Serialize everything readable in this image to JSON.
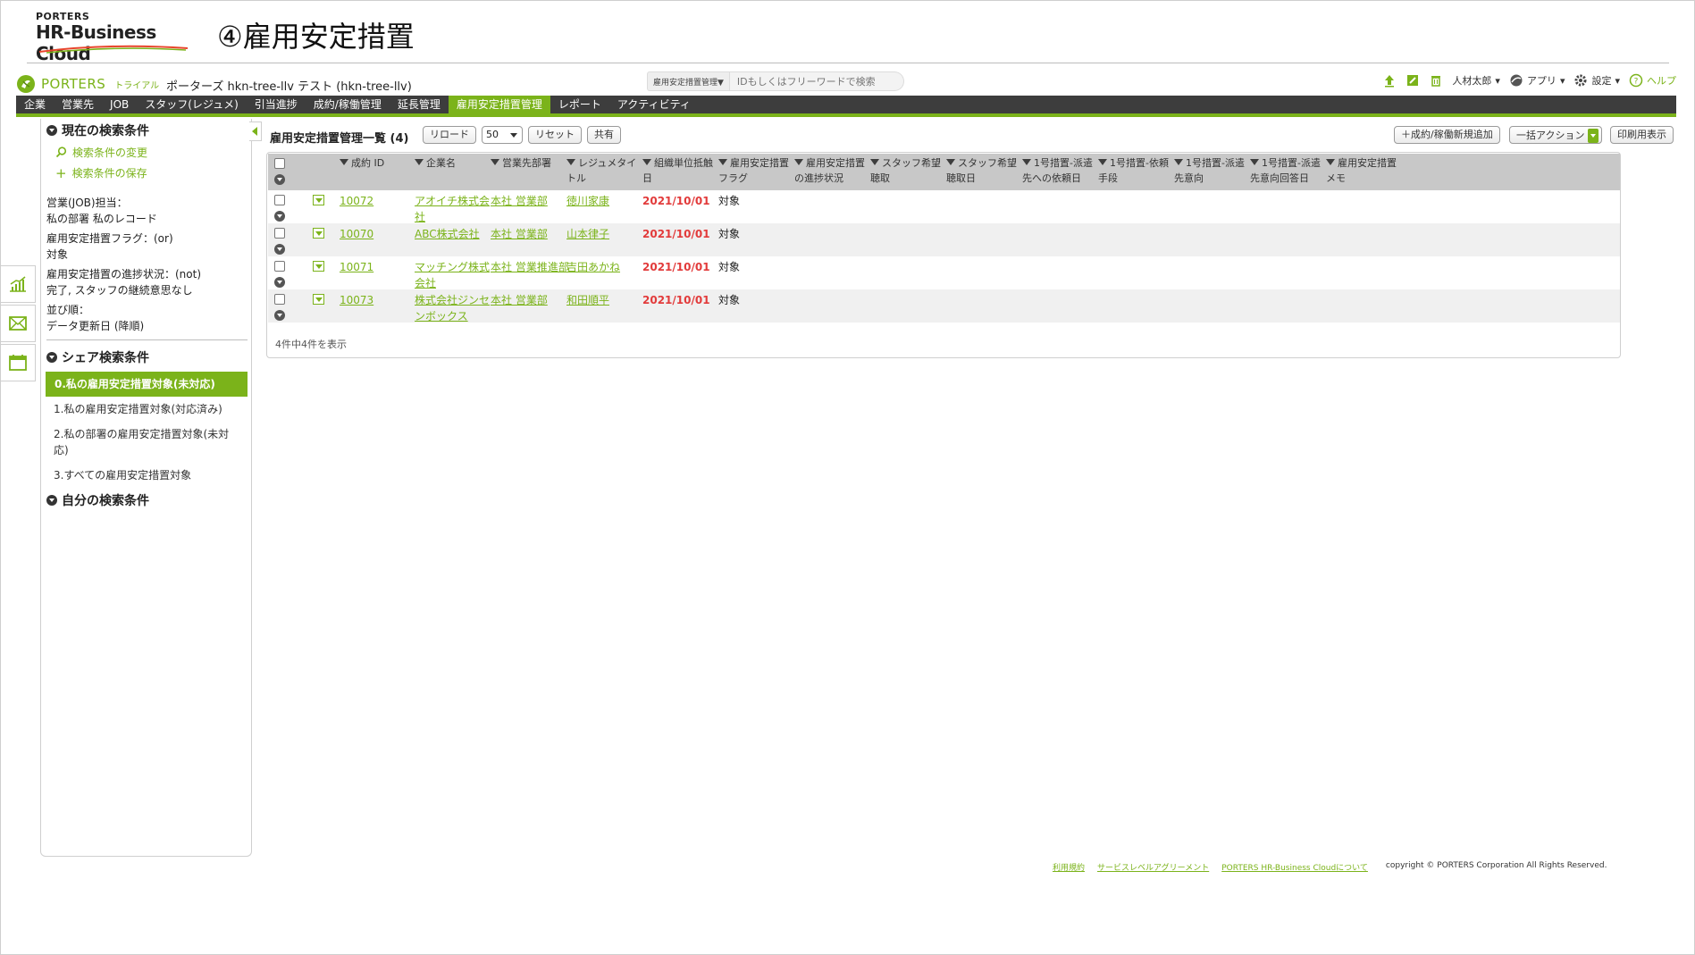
{
  "slide": {
    "logo_top": "PORTERS",
    "logo_main": "HR-Business Cloud",
    "title": "④雇用安定措置"
  },
  "header": {
    "brand": "PORTERS",
    "trial": "トライアル",
    "tenant": "ポーターズ hkn-tree-llv テスト (hkn-tree-llv)",
    "search_scope": "雇用安定措置管理▼",
    "search_placeholder": "IDもしくはフリーワードで検索",
    "user": "人材太郎",
    "apps": "アプリ",
    "settings": "設定",
    "help": "ヘルプ"
  },
  "nav": [
    {
      "label": "企業"
    },
    {
      "label": "営業先"
    },
    {
      "label": "JOB"
    },
    {
      "label": "スタッフ(レジュメ)"
    },
    {
      "label": "引当進捗"
    },
    {
      "label": "成約/稼働管理"
    },
    {
      "label": "延長管理"
    },
    {
      "label": "雇用安定措置管理",
      "active": true
    },
    {
      "label": "レポート"
    },
    {
      "label": "アクティビティ"
    }
  ],
  "sidebar": {
    "current_heading": "現在の検索条件",
    "change_link": "検索条件の変更",
    "save_link": "検索条件の保存",
    "conditions": [
      "営業(JOB)担当：",
      "私の部署 私のレコード",
      "雇用安定措置フラグ：(or)",
      "対象",
      "雇用安定措置の進捗状況：(not)",
      "完了, スタッフの継続意思なし",
      "並び順：",
      "データ更新日 (降順)"
    ],
    "share_heading": "シェア検索条件",
    "saved": [
      {
        "label": "0.私の雇用安定措置対象(未対応)",
        "active": true
      },
      {
        "label": "1.私の雇用安定措置対象(対応済み)"
      },
      {
        "label": "2.私の部署の雇用安定措置対象(未対応)"
      },
      {
        "label": "3.すべての雇用安定措置対象"
      }
    ],
    "own_heading": "自分の検索条件"
  },
  "toolbar": {
    "title": "雇用安定措置管理一覧 (4)",
    "reload": "リロード",
    "page_size": "50",
    "reset": "リセット",
    "share": "共有",
    "add_new": "＋成約/稼働新規追加",
    "bulk_action": "一括アクション",
    "print": "印刷用表示"
  },
  "table": {
    "headers": [
      [
        "成約 ID",
        ""
      ],
      [
        "企業名",
        ""
      ],
      [
        "営業先部署",
        ""
      ],
      [
        "レジュメタイ",
        "トル"
      ],
      [
        "組織単位抵触",
        "日"
      ],
      [
        "雇用安定措置",
        "フラグ"
      ],
      [
        "雇用安定措置",
        "の進捗状況"
      ],
      [
        "スタッフ希望",
        "聴取"
      ],
      [
        "スタッフ希望",
        "聴取日"
      ],
      [
        "1号措置-派遣",
        "先への依頼日"
      ],
      [
        "1号措置-依頼",
        "手段"
      ],
      [
        "1号措置-派遣",
        "先意向"
      ],
      [
        "1号措置-派遣",
        "先意向回答日"
      ],
      [
        "雇用安定措置",
        "メモ"
      ]
    ],
    "rows": [
      {
        "id": "10072",
        "company": [
          "アオイチ株式会",
          "社"
        ],
        "dept": "本社 営業部",
        "staff": "徳川家康",
        "date": "2021/10/01",
        "flag": "対象"
      },
      {
        "id": "10070",
        "company": [
          "ABC株式会社",
          ""
        ],
        "dept": "本社 営業部",
        "staff": "山本律子",
        "date": "2021/10/01",
        "flag": "対象"
      },
      {
        "id": "10071",
        "company": [
          "マッチング株式",
          "会社"
        ],
        "dept": "本社 営業推進部",
        "staff": "吉田あかね",
        "date": "2021/10/01",
        "flag": "対象"
      },
      {
        "id": "10073",
        "company": [
          "株式会社ジンセ",
          "ンボックス"
        ],
        "dept": "本社 営業部",
        "staff": "和田順平",
        "date": "2021/10/01",
        "flag": "対象"
      }
    ],
    "count_text": "4件中4件を表示"
  },
  "footer": {
    "terms": "利用規約",
    "sla": "サービスレベルアグリーメント",
    "about": "PORTERS HR-Business Cloudについて",
    "copyright": "copyright © PORTERS Corporation All Rights Reserved."
  },
  "colors": {
    "accent": "#7bb31a",
    "nav_bg": "#3d3d3d",
    "date_red": "#e23b3b",
    "header_gray": "#c8c8c8"
  }
}
